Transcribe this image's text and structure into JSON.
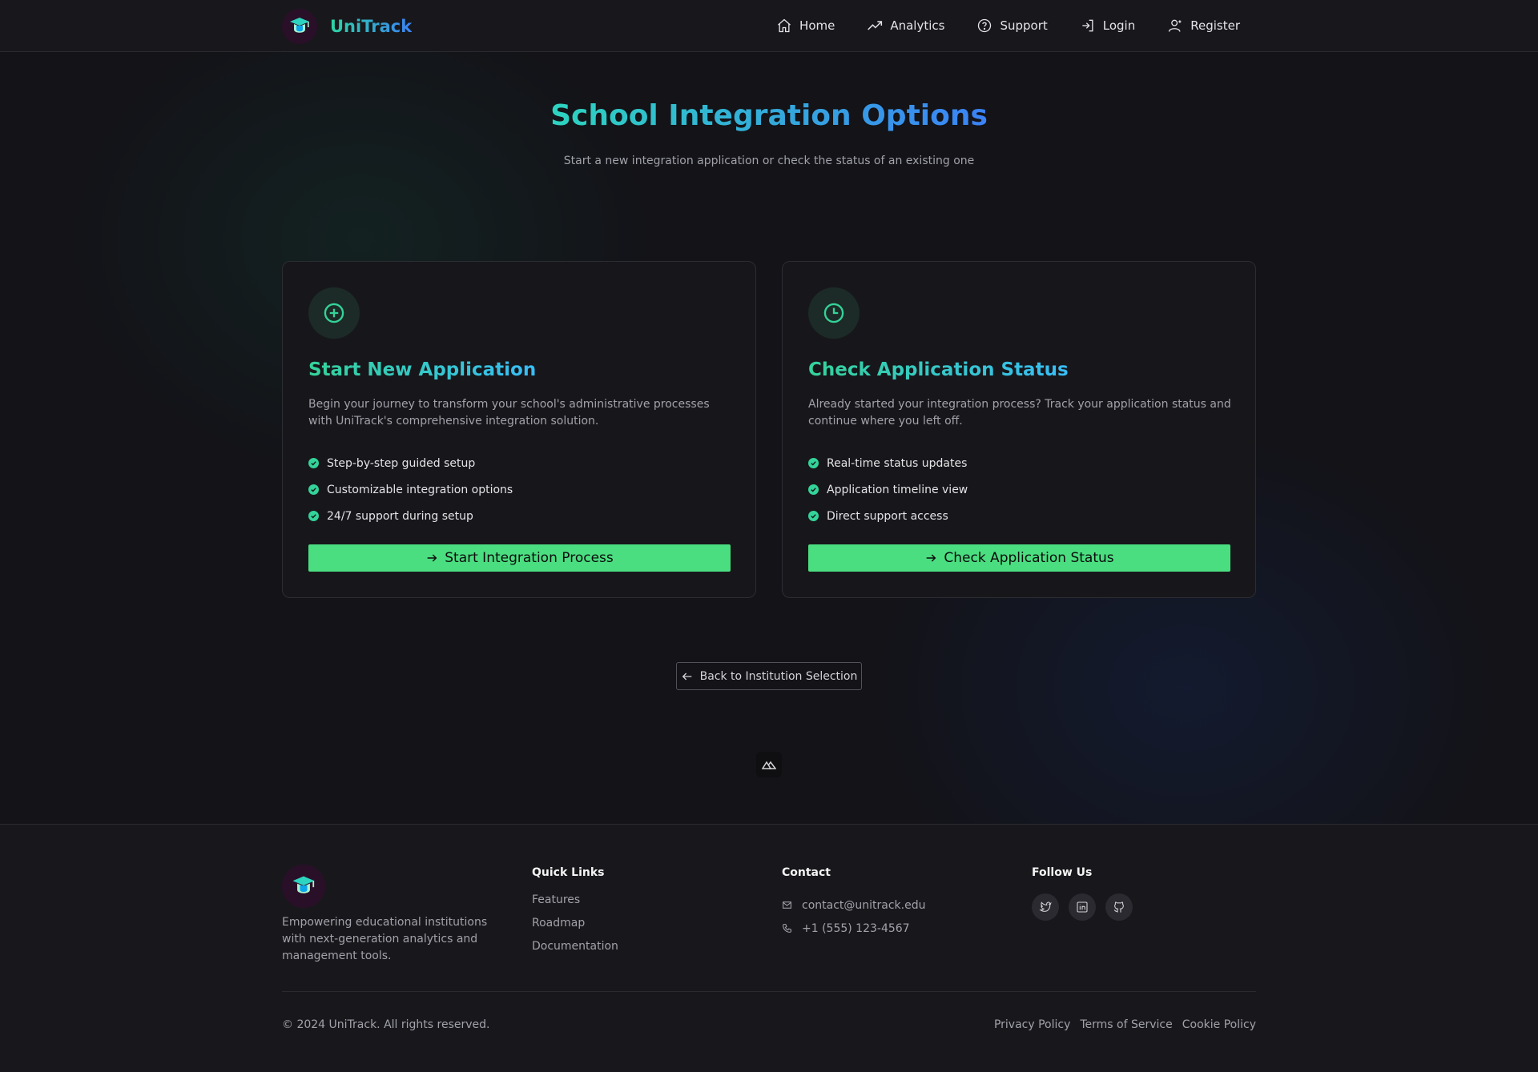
{
  "brand": {
    "name": "UniTrack"
  },
  "nav": {
    "links": [
      {
        "label": "Home",
        "icon": "home-icon"
      },
      {
        "label": "Analytics",
        "icon": "trend-icon"
      },
      {
        "label": "Support",
        "icon": "help-circle-icon"
      },
      {
        "label": "Login",
        "icon": "login-icon"
      },
      {
        "label": "Register",
        "icon": "user-plus-icon"
      }
    ]
  },
  "hero": {
    "title": "School Integration Options",
    "subtitle": "Start a new integration application or check the status of an existing one"
  },
  "cards": [
    {
      "icon": "plus-circle-icon",
      "title": "Start New Application",
      "description": "Begin your journey to transform your school's administrative processes with UniTrack's comprehensive integration solution.",
      "features": [
        "Step-by-step guided setup",
        "Customizable integration options",
        "24/7 support during setup"
      ],
      "button": "Start Integration Process"
    },
    {
      "icon": "clock-icon",
      "title": "Check Application Status",
      "description": "Already started your integration process? Track your application status and continue where you left off.",
      "features": [
        "Real-time status updates",
        "Application timeline view",
        "Direct support access"
      ],
      "button": "Check Application Status"
    }
  ],
  "back_button": "Back to Institution Selection",
  "footer": {
    "tagline": "Empowering educational institutions with next-generation analytics and management tools.",
    "quick_links": {
      "title": "Quick Links",
      "items": [
        "Features",
        "Roadmap",
        "Documentation"
      ]
    },
    "contact": {
      "title": "Contact",
      "email": "contact@unitrack.edu",
      "phone": "+1 (555) 123-4567"
    },
    "follow": {
      "title": "Follow Us",
      "icons": [
        "twitter-icon",
        "linkedin-icon",
        "github-icon"
      ]
    },
    "copyright": "© 2024 UniTrack. All rights reserved.",
    "legal": [
      "Privacy Policy",
      "Terms of Service",
      "Cookie Policy"
    ]
  },
  "colors": {
    "accent": "#4ade80",
    "brand_gradient_start": "#2dd4bf",
    "brand_gradient_end": "#3b82f6"
  }
}
